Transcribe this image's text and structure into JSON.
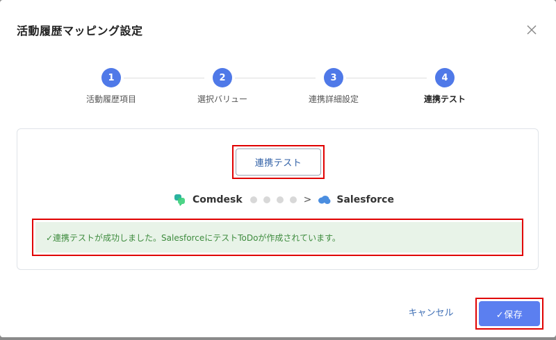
{
  "dialog": {
    "title": "活動履歴マッピング設定",
    "close_icon": "close-icon"
  },
  "steps": [
    {
      "number": "1",
      "label": "活動履歴項目"
    },
    {
      "number": "2",
      "label": "選択バリュー"
    },
    {
      "number": "3",
      "label": "連携詳細設定"
    },
    {
      "number": "4",
      "label": "連携テスト",
      "active": true
    }
  ],
  "test": {
    "button_label": "連携テスト",
    "source_name": "Comdesk",
    "arrow": ">",
    "target_name": "Salesforce",
    "source_icon": "comdesk-logo-icon",
    "target_icon": "salesforce-cloud-icon",
    "success_message": "✓連携テストが成功しました。SalesforceにテストToDoが作成されています。"
  },
  "footer": {
    "cancel_label": "キャンセル",
    "save_label": "✓保存"
  },
  "colors": {
    "accent": "#4f79e8",
    "save_button": "#5b7ff0",
    "success_bg": "#e8f3e8",
    "success_text": "#3d8b3d",
    "highlight": "#e00000"
  }
}
